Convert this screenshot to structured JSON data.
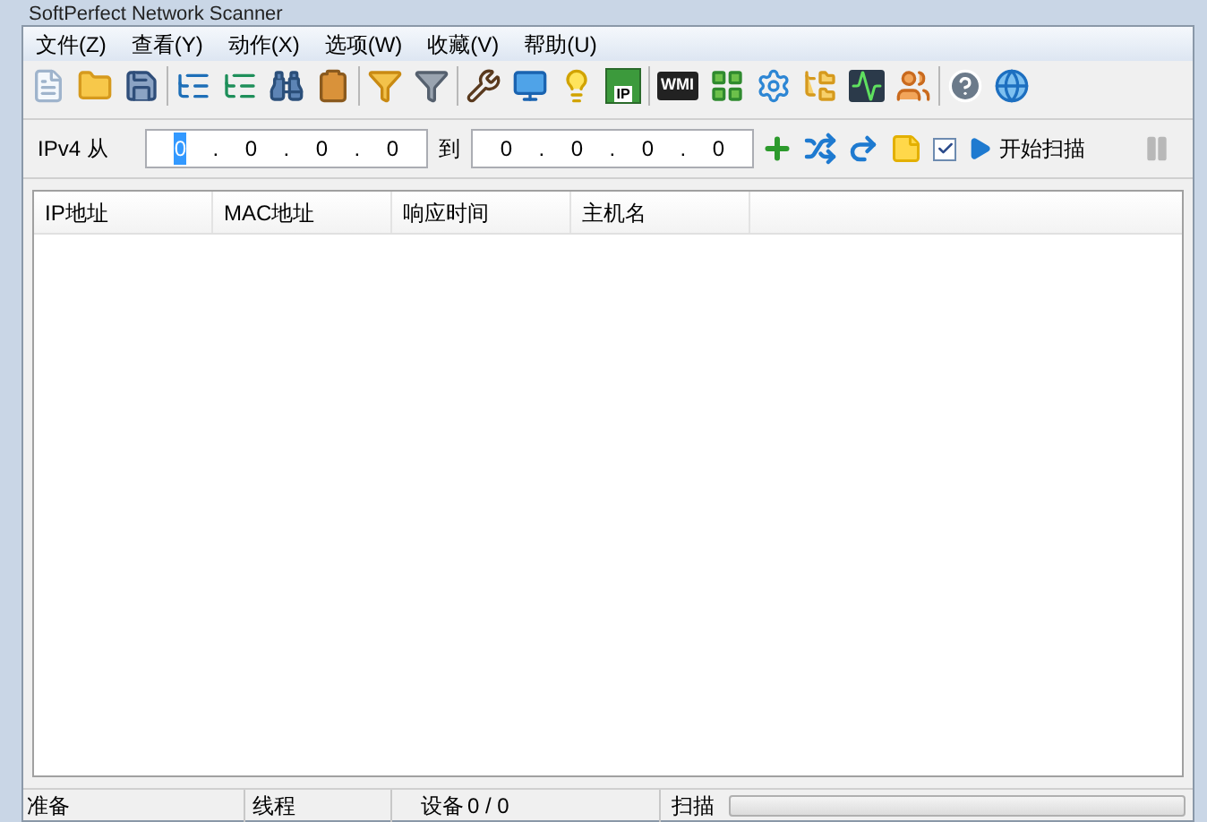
{
  "window": {
    "title": "SoftPerfect Network Scanner"
  },
  "menu": [
    "文件(Z)",
    "查看(Y)",
    "动作(X)",
    "选项(W)",
    "收藏(V)",
    "帮助(U)"
  ],
  "toolbar": [
    [
      {
        "kind": "new"
      },
      {
        "kind": "open"
      },
      {
        "kind": "save"
      }
    ],
    [
      {
        "kind": "tree-collapse"
      },
      {
        "kind": "tree-expand"
      },
      {
        "kind": "find"
      },
      {
        "kind": "clipboard"
      }
    ],
    [
      {
        "kind": "filter"
      },
      {
        "kind": "filter-more"
      }
    ],
    [
      {
        "kind": "tools"
      },
      {
        "kind": "monitor"
      },
      {
        "kind": "bulb"
      },
      {
        "kind": "ip-card",
        "label": "IP"
      }
    ],
    [
      {
        "kind": "wmi",
        "label": "WMI"
      },
      {
        "kind": "blocks"
      },
      {
        "kind": "gear"
      },
      {
        "kind": "folder-net"
      },
      {
        "kind": "pulse"
      },
      {
        "kind": "users"
      }
    ],
    [
      {
        "kind": "help"
      },
      {
        "kind": "globe"
      }
    ]
  ],
  "range": {
    "label": "IPv4 从",
    "from": {
      "octets": [
        "0",
        "0",
        "0",
        "0"
      ],
      "separator": "."
    },
    "to_label": "到",
    "to": {
      "octets": [
        "0",
        "0",
        "0",
        "0"
      ],
      "separator": "."
    },
    "option_checked": true,
    "start_button": "开始扫描"
  },
  "table": {
    "columns": [
      "IP地址",
      "MAC地址",
      "响应时间",
      "主机名"
    ]
  },
  "status_bar": {
    "state": "准备",
    "threads_label": "线程",
    "devices_label": "设备",
    "devices": "0 / 0",
    "scan_label": "扫描",
    "progress": {
      "level": 0
    }
  }
}
